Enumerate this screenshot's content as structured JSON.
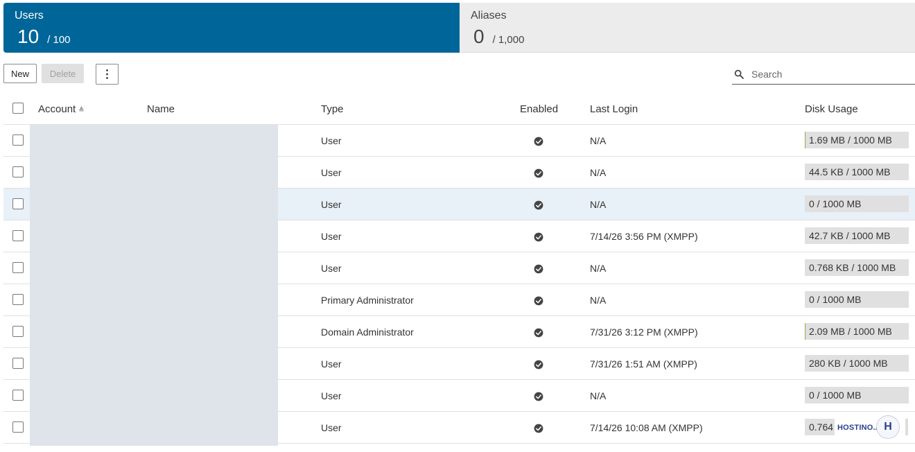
{
  "stats": {
    "users": {
      "title": "Users",
      "count": "10",
      "limit": "/ 100"
    },
    "aliases": {
      "title": "Aliases",
      "count": "0",
      "limit": "/ 1,000"
    }
  },
  "toolbar": {
    "new_label": "New",
    "delete_label": "Delete",
    "more_label": "⋮",
    "search_placeholder": "Search"
  },
  "columns": {
    "account": "Account",
    "name": "Name",
    "type": "Type",
    "enabled": "Enabled",
    "last_login": "Last Login",
    "disk_usage": "Disk Usage"
  },
  "sort_indicator": "≜",
  "rows": [
    {
      "type": "User",
      "enabled": true,
      "last_login": "N/A",
      "disk": "1.69 MB / 1000 MB",
      "disk_fraction": 0.0017,
      "selected": false
    },
    {
      "type": "User",
      "enabled": true,
      "last_login": "N/A",
      "disk": "44.5 KB / 1000 MB",
      "disk_fraction": 0.0,
      "selected": false
    },
    {
      "type": "User",
      "enabled": true,
      "last_login": "N/A",
      "disk": "0 / 1000 MB",
      "disk_fraction": 0.0,
      "selected": true
    },
    {
      "type": "User",
      "enabled": true,
      "last_login": "7/14/26 3:56 PM (XMPP)",
      "disk": "42.7 KB / 1000 MB",
      "disk_fraction": 0.0,
      "selected": false
    },
    {
      "type": "User",
      "enabled": true,
      "last_login": "N/A",
      "disk": "0.768 KB / 1000 MB",
      "disk_fraction": 0.0,
      "selected": false
    },
    {
      "type": "Primary Administrator",
      "enabled": true,
      "last_login": "N/A",
      "disk": "0 / 1000 MB",
      "disk_fraction": 0.0,
      "selected": false
    },
    {
      "type": "Domain Administrator",
      "enabled": true,
      "last_login": "7/31/26 3:12 PM (XMPP)",
      "disk": "2.09 MB / 1000 MB",
      "disk_fraction": 0.0021,
      "selected": false
    },
    {
      "type": "User",
      "enabled": true,
      "last_login": "7/31/26 1:51 AM (XMPP)",
      "disk": "280 KB / 1000 MB",
      "disk_fraction": 0.0,
      "selected": false
    },
    {
      "type": "User",
      "enabled": true,
      "last_login": "N/A",
      "disk": "0 / 1000 MB",
      "disk_fraction": 0.0,
      "selected": false
    },
    {
      "type": "User",
      "enabled": true,
      "last_login": "7/14/26 10:08 AM (XMPP)",
      "disk": "0.764",
      "disk_fraction": 0.0,
      "selected": false
    }
  ],
  "brand": {
    "wordmark": "HOSTINO.AI",
    "badge": "H"
  },
  "colors": {
    "accent": "#006699",
    "selected_row": "#e8f0f8",
    "disk_fill": "#8ab04a"
  },
  "icons": {
    "search": "search-icon",
    "enabled": "check-circle-icon",
    "more": "more-vert-icon"
  }
}
